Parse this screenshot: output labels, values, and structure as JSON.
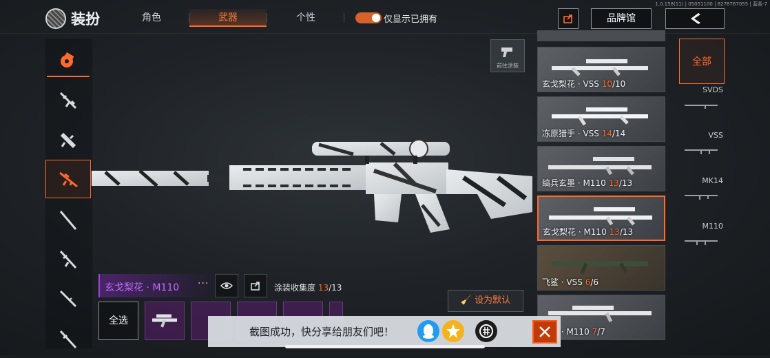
{
  "version": "1.0.158(11) | 05051100 | 8278767055 | 蓝奏-7",
  "header": {
    "title": "装扮",
    "tabs": [
      {
        "label": "角色",
        "active": false
      },
      {
        "label": "武器",
        "active": true
      },
      {
        "label": "个性",
        "active": false
      }
    ],
    "toggle_label": "仅显示已拥有",
    "toggle_on": true,
    "brand_label": "品牌馆"
  },
  "colors": {
    "accent": "#ff6a2a",
    "rare": "#c36cff"
  },
  "left_categories": [
    {
      "icon": "grenade-icon",
      "active": false
    },
    {
      "icon": "rifle-icon",
      "active": false
    },
    {
      "icon": "smg-icon",
      "active": false
    },
    {
      "icon": "sniper-icon",
      "active": true
    },
    {
      "icon": "shotgun-icon",
      "active": false
    },
    {
      "icon": "assault-rifle-icon",
      "active": false
    },
    {
      "icon": "dmr-icon",
      "active": false
    },
    {
      "icon": "lmg-icon",
      "active": false
    }
  ],
  "paint_shortcut_label": "前往涂装",
  "skin_cards": [
    {
      "name": "玄戈梨花 · VSS ",
      "owned": "10",
      "total": "/10",
      "active": false
    },
    {
      "name": "冻原猎手 · VSS ",
      "owned": "14",
      "total": "/14",
      "active": false
    },
    {
      "name": "缟兵玄墨 · M110 ",
      "owned": "13",
      "total": "/13",
      "active": false
    },
    {
      "name": "玄戈梨花 · M110 ",
      "owned": "13",
      "total": "/13",
      "active": true
    },
    {
      "name": "飞鲨 · VSS ",
      "owned": "6",
      "total": "/6",
      "active": false
    },
    {
      "name": "国际 · M110 ",
      "owned": "7",
      "total": "/7",
      "active": false
    }
  ],
  "weapon_types": {
    "all_label": "全部",
    "items": [
      "SVDS",
      "VSS",
      "MK14",
      "M110"
    ]
  },
  "selected_skin": {
    "name": "玄戈梨花 · M110",
    "more": "···",
    "collect_label": "涂装收集度 ",
    "collect_owned": "13",
    "collect_total": "/13"
  },
  "set_default_label": "设为默认",
  "select_all_label": "全选",
  "toast": {
    "text": "截图成功，快分享给朋友们吧！",
    "share_targets": [
      "qq-icon",
      "qzone-icon",
      "sharecode-icon"
    ]
  }
}
